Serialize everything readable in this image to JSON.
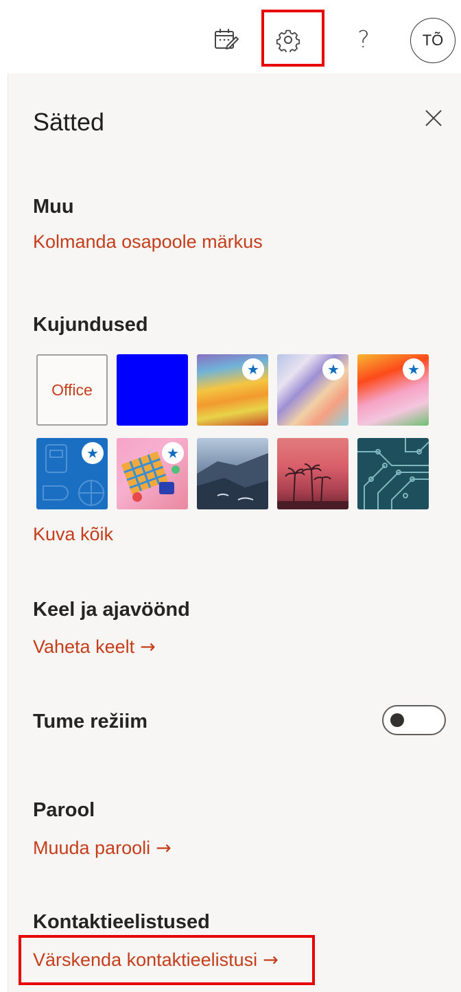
{
  "topbar": {
    "icons": [
      "calendar-check-icon",
      "gear-icon",
      "help-icon"
    ],
    "help_glyph": "?",
    "avatar_initials": "TÕ",
    "highlight_color": "#e60000"
  },
  "panel": {
    "title": "Sätted",
    "close_icon": "close-icon"
  },
  "sections": {
    "other": {
      "heading": "Muu",
      "link": "Kolmanda osapoole märkus"
    },
    "themes": {
      "heading": "Kujundused",
      "office_label": "Office",
      "view_all": "Kuva kõik"
    },
    "language": {
      "heading": "Keel ja ajavöönd",
      "link": "Vaheta keelt"
    },
    "dark_mode": {
      "label": "Tume režiim",
      "enabled": false
    },
    "password": {
      "heading": "Parool",
      "link": "Muuda parooli"
    },
    "contacts": {
      "heading": "Kontaktieelistused",
      "link": "Värskenda kontaktieelistusi"
    }
  },
  "arrow_glyph": "→",
  "star_glyph": "★",
  "colors": {
    "accent_link": "#c43e1c",
    "panel_bg": "#f8f6f4",
    "star_blue": "#0f6cbd",
    "highlight": "#e60000"
  }
}
